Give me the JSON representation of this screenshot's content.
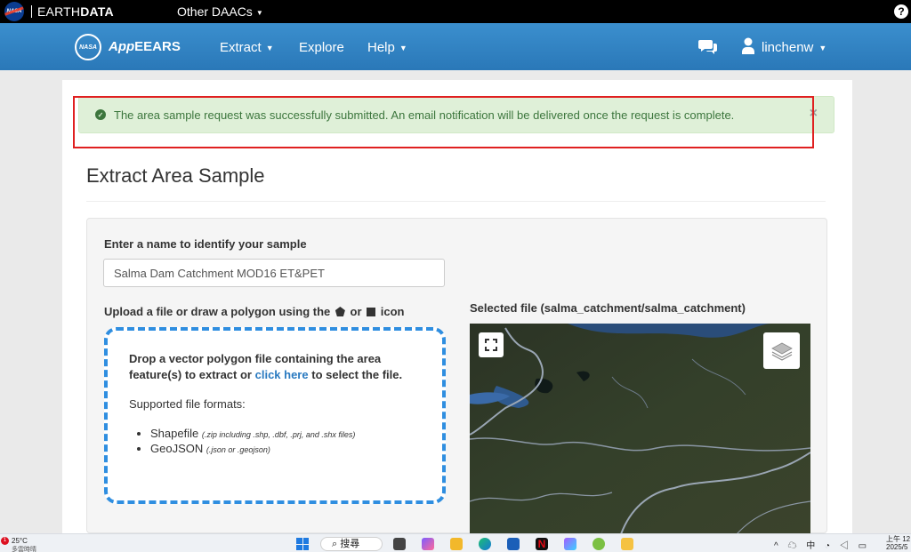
{
  "earthdata": {
    "title_light": "EARTH",
    "title_bold": "DATA",
    "daacs_label": "Other DAACs",
    "help_label": "?",
    "nasa_label": "NASA"
  },
  "nav": {
    "brand_app": "App",
    "brand_rest": "EEARS",
    "extract": "Extract",
    "explore": "Explore",
    "help": "Help",
    "user": "linchenw"
  },
  "alert": {
    "message": "The area sample request was successfully submitted. An email notification will be delivered once the request is complete.",
    "close": "×"
  },
  "page": {
    "title": "Extract Area Sample"
  },
  "form": {
    "name_label": "Enter a name to identify your sample",
    "name_value": "Salma Dam Catchment MOD16 ET&PET",
    "upload_label_pre": "Upload a file or draw a polygon using the",
    "upload_label_or": "or",
    "upload_label_post": "icon",
    "selected_file_label": "Selected file (salma_catchment/salma_catchment)"
  },
  "dropzone": {
    "text_pre": "Drop a vector polygon file containing the area feature(s) to extract or",
    "link": "click here",
    "text_post": "to select the file.",
    "formats_label": "Supported file formats:",
    "formats": [
      {
        "name": "Shapefile",
        "note": "(.zip including .shp, .dbf, .prj, and .shx files)"
      },
      {
        "name": "GeoJSON",
        "note": "(.json or .geojson)"
      }
    ]
  },
  "taskbar": {
    "badge": "1",
    "temperature": "25°C",
    "weather": "多雲時晴",
    "search": "搜尋",
    "tray": "^ ☁ 中 ◔ ◁ ▭",
    "time_line1": "上午 12",
    "time_line2": "2025/5"
  },
  "colors": {
    "earthdata_bar": "#000000",
    "nav_blue": "#2e86c8",
    "alert_bg": "#dff0d8",
    "alert_text": "#3c763d",
    "annotation_red": "#e02020",
    "dropzone_border": "#2f8ee0"
  }
}
